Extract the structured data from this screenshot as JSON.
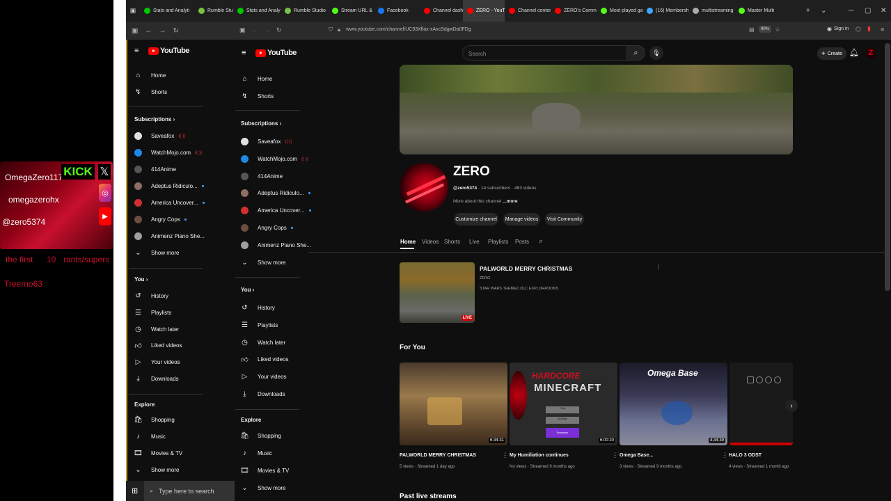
{
  "browser": {
    "tabs": [
      {
        "label": "Stats and Analyti",
        "color": "#00c800"
      },
      {
        "label": "Rumble Stu",
        "color": "#7ac143"
      },
      {
        "label": "Stats and Analyti",
        "color": "#00c800"
      },
      {
        "label": "Rumble Studio",
        "color": "#7ac143"
      },
      {
        "label": "Stream URL & Ke",
        "color": "#53fc18"
      },
      {
        "label": "Facebook",
        "color": "#1877f2"
      },
      {
        "label": "Channel dashboa",
        "color": "#ff0000"
      },
      {
        "label": "ZERO - YouTu",
        "color": "#ff0000"
      },
      {
        "label": "Channel content",
        "color": "#ff0000"
      },
      {
        "label": "ZERO's Commun",
        "color": "#ff0000"
      },
      {
        "label": "Most played gam",
        "color": "#53fc18"
      },
      {
        "label": "(16) Membersh",
        "color": "#3ea6ff"
      },
      {
        "label": "multistreaming fi",
        "color": "#aaaaaa"
      },
      {
        "label": "Master Multi",
        "color": "#53fc18"
      }
    ],
    "url": "www.youtube.com/channel/UC93Xflax-xAxcSdgwDa0FDg",
    "zoom": "90%",
    "sign_in": "Sign in"
  },
  "overlay": {
    "name1": "OmegaZero117",
    "kick": "KICK",
    "name2": "omegazerohx",
    "name3": "@zero5374",
    "line1a": "the first",
    "line1b": "10",
    "line1c": "rants/supers",
    "line2": "Treerno63"
  },
  "left_window": {
    "logo": "YouTube",
    "nav": [
      "Home",
      "Shorts"
    ],
    "subscriptions_title": "Subscriptions",
    "subscriptions": [
      {
        "name": "Saveafox",
        "color": "#e0e0e0"
      },
      {
        "name": "WatchMojo.com",
        "color": "#1e88e5"
      },
      {
        "name": "414Anime",
        "color": "#555555"
      },
      {
        "name": "Adeptus Ridiculo...",
        "color": "#8d6e63"
      },
      {
        "name": "America Uncover...",
        "color": "#d32f2f"
      },
      {
        "name": "Angry Cops",
        "color": "#6d4c41"
      },
      {
        "name": "Animenz Piano She...",
        "color": "#9e9e9e"
      }
    ],
    "show_more": "Show more",
    "you_title": "You",
    "you_items": [
      "History",
      "Playlists",
      "Watch later",
      "Liked videos",
      "Your videos",
      "Downloads"
    ],
    "explore_title": "Explore",
    "explore_items": [
      "Shopping",
      "Music",
      "Movies & TV"
    ],
    "show_more2": "Show more",
    "taskbar_search": "Type here to search"
  },
  "main": {
    "logo": "YouTube",
    "search_placeholder": "Search",
    "create_label": "Create",
    "nav": [
      "Home",
      "Shorts"
    ],
    "subscriptions_title": "Subscriptions",
    "subscriptions": [
      {
        "name": "Saveafox",
        "color": "#e0e0e0"
      },
      {
        "name": "WatchMojo.com",
        "color": "#1e88e5"
      },
      {
        "name": "414Anime",
        "color": "#555555"
      },
      {
        "name": "Adeptus Ridiculo...",
        "color": "#8d6e63"
      },
      {
        "name": "America Uncover...",
        "color": "#d32f2f"
      },
      {
        "name": "Angry Cops",
        "color": "#6d4c41"
      },
      {
        "name": "Animenz Piano She...",
        "color": "#9e9e9e"
      }
    ],
    "show_more": "Show more",
    "you_title": "You",
    "you_items": [
      "History",
      "Playlists",
      "Watch later",
      "Liked videos",
      "Your videos",
      "Downloads"
    ],
    "explore_title": "Explore",
    "explore_items": [
      "Shopping",
      "Music",
      "Movies & TV"
    ],
    "show_more2": "Show more",
    "channel": {
      "name": "ZERO",
      "handle": "@zero5374",
      "stats": " · 14 subscribers · 463 videos",
      "about": "More about this channel",
      "about_more": "...more",
      "buttons": [
        "Customize channel",
        "Manage videos",
        "Visit Community"
      ],
      "tabs": [
        "Home",
        "Videos",
        "Shorts",
        "Live",
        "Playlists",
        "Posts"
      ]
    },
    "featured": {
      "title": "PALWORLD MERRY CHRISTMAS",
      "channel": "ZERO",
      "description": "STAR WARS THEMED DLC EXPLORATIONS",
      "badge": "LIVE"
    },
    "for_you_title": "For You",
    "videos": [
      {
        "title": "PALWORLD MERRY CHRISTMAS",
        "meta": "5 views · Streamed 1 day ago",
        "duration": "6:34:31"
      },
      {
        "title": "My Humiliation continues",
        "meta": "No views · Streamed 9 months ago",
        "duration": "6:00:20"
      },
      {
        "title": "Omega Base...",
        "meta": "3 views · Streamed 9 months ago",
        "duration": "4:34:39"
      },
      {
        "title": "HALO 3 ODST",
        "meta": "4 views · Streamed 1 month ago",
        "duration": ""
      }
    ],
    "thumb_text": {
      "hardcore": "HARDCORE",
      "minecraft": "MINECRAFT",
      "omega_base": "Omega Base",
      "menu1": "Play",
      "menu2": "Settings",
      "menu3": "Respawn"
    },
    "past_live": "Past live streams"
  }
}
